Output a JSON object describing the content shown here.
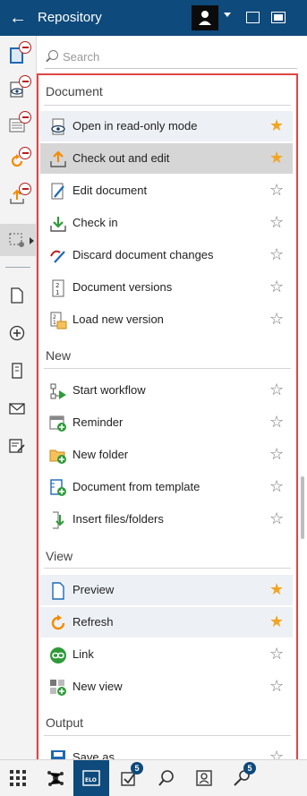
{
  "header": {
    "title": "Repository"
  },
  "search": {
    "placeholder": "Search"
  },
  "sections": {
    "document": "Document",
    "new": "New",
    "view": "View",
    "output": "Output"
  },
  "items": {
    "open_readonly": "Open in read-only mode",
    "check_out_edit": "Check out and edit",
    "edit_document": "Edit document",
    "check_in": "Check in",
    "discard_changes": "Discard document changes",
    "document_versions": "Document versions",
    "load_new_version": "Load new version",
    "start_workflow": "Start workflow",
    "reminder": "Reminder",
    "new_folder": "New folder",
    "document_from_template": "Document from template",
    "insert_files": "Insert files/folders",
    "preview": "Preview",
    "refresh": "Refresh",
    "link": "Link",
    "new_view": "New view",
    "save_as": "Save as"
  },
  "bottombar": {
    "tasks_badge": "5",
    "search_badge": "5",
    "elo_label": "ELO"
  },
  "colors": {
    "brand": "#0e4a7b",
    "favorite": "#f2a521",
    "highlight_border": "#e04545"
  }
}
